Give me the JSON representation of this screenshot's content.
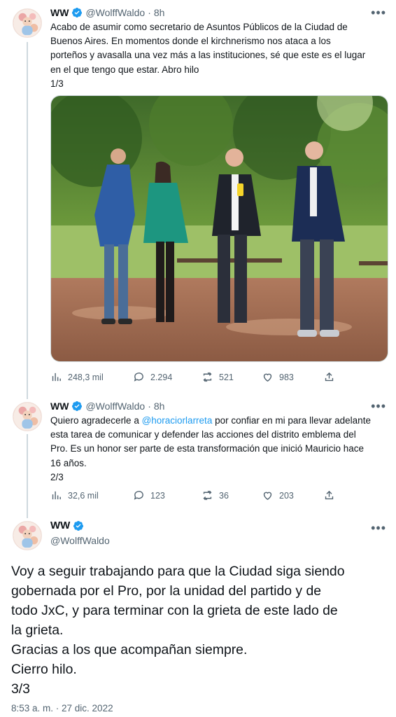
{
  "tweets": [
    {
      "name": "WW",
      "handle": "@WolffWaldo",
      "dot": "·",
      "time": "8h",
      "lines": [
        "Acabo de asumir como secretario de Asuntos Públicos de la Ciudad de",
        "Buenos Aires. En momentos donde el kirchnerismo nos ataca a los",
        "porteños y avasalla una vez más a las instituciones, sé que este es el lugar",
        "en el que tengo que estar. Abro hilo",
        "1/3"
      ],
      "stats": {
        "views": "248,3 mil",
        "replies": "2.294",
        "retweets": "521",
        "likes": "983"
      }
    },
    {
      "name": "WW",
      "handle": "@WolffWaldo",
      "dot": "·",
      "time": "8h",
      "line1_before": "Quiero agradecerle a ",
      "mention": "@horaciorlarreta",
      "line1_after": " por confiar en mi para llevar adelante",
      "lines": [
        "esta tarea de comunicar y defender las acciones del distrito emblema del",
        "Pro. Es un honor ser parte de esta transformación que inició Mauricio hace",
        "16 años.",
        "2/3"
      ],
      "stats": {
        "views": "32,6 mil",
        "replies": "123",
        "retweets": "36",
        "likes": "203"
      }
    }
  ],
  "main_tweet": {
    "name": "WW",
    "handle": "@WolffWaldo",
    "lines": [
      "Voy a seguir trabajando para que la Ciudad siga siendo",
      "gobernada por el Pro, por la unidad del partido y de",
      "todo JxC, y para terminar con la grieta de este lado de",
      "la grieta.",
      "Gracias a los que acompañan siempre.",
      "Cierro hilo.",
      "3/3"
    ],
    "timestamp": "8:53 a. m. · 27 dic. 2022"
  },
  "more_glyph": "•••",
  "colors": {
    "accent": "#1d9bf0",
    "muted": "#536471",
    "text": "#0f1419",
    "line": "#cfd9de"
  },
  "icons": [
    "verified-badge-icon",
    "views-icon",
    "reply-icon",
    "retweet-icon",
    "like-icon",
    "share-icon",
    "more-icon"
  ]
}
